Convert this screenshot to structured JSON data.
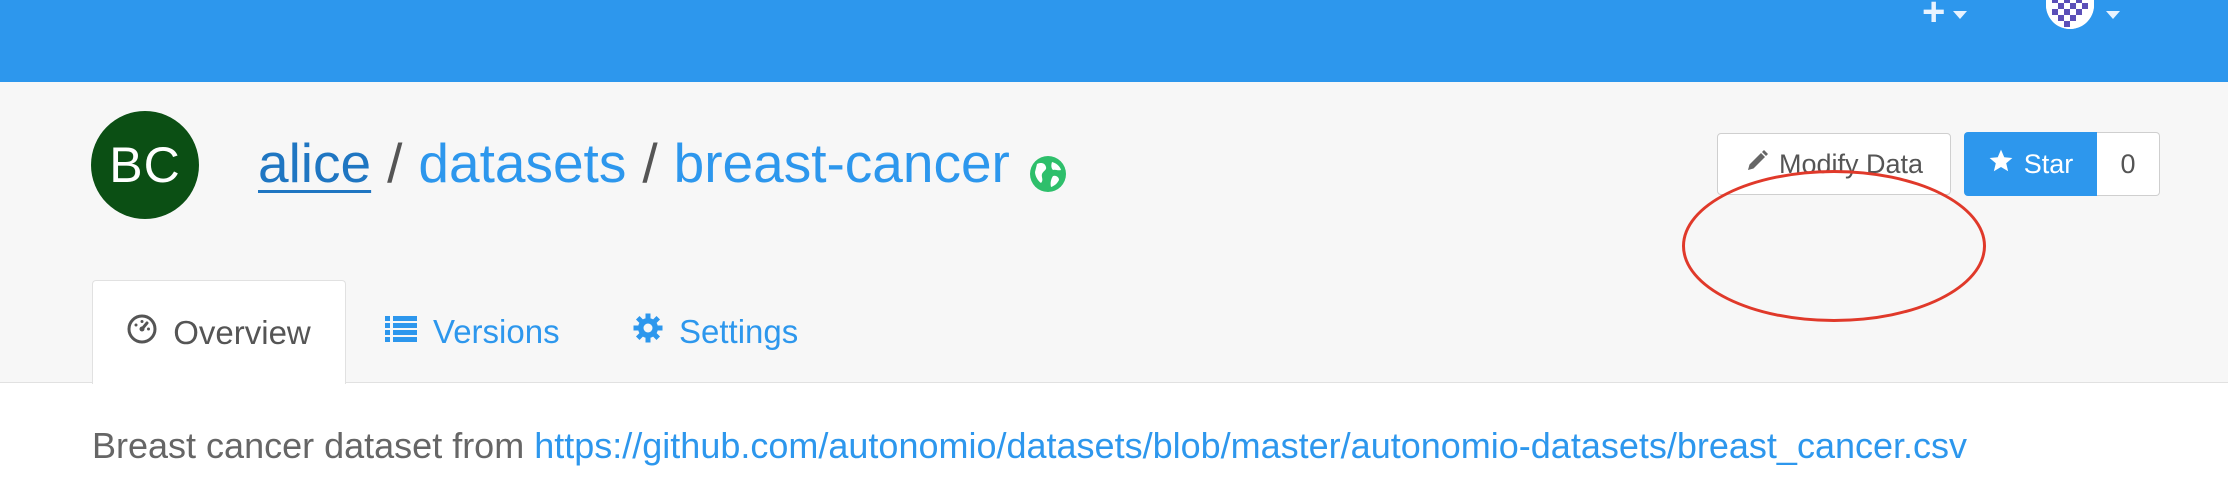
{
  "navbar": {
    "add_icon": "plus-icon",
    "user_icon": "user-avatar-icon",
    "colors": {
      "background": "#2d97ed"
    }
  },
  "dataset": {
    "avatar_initials": "BC",
    "avatar_color": "#0b4f14",
    "owner": "alice",
    "separator": "/",
    "collection": "datasets",
    "name": "breast-cancer",
    "visibility_icon": "globe-icon"
  },
  "actions": {
    "modify_label": "Modify Data",
    "star_label": "Star",
    "star_count": "0"
  },
  "tabs": [
    {
      "label": "Overview",
      "icon": "dashboard-icon",
      "active": true
    },
    {
      "label": "Versions",
      "icon": "list-icon",
      "active": false
    },
    {
      "label": "Settings",
      "icon": "gear-icon",
      "active": false
    }
  ],
  "description": {
    "text": "Breast cancer dataset from",
    "link": "https://github.com/autonomio/datasets/blob/master/autonomio-datasets/breast_cancer.csv"
  }
}
